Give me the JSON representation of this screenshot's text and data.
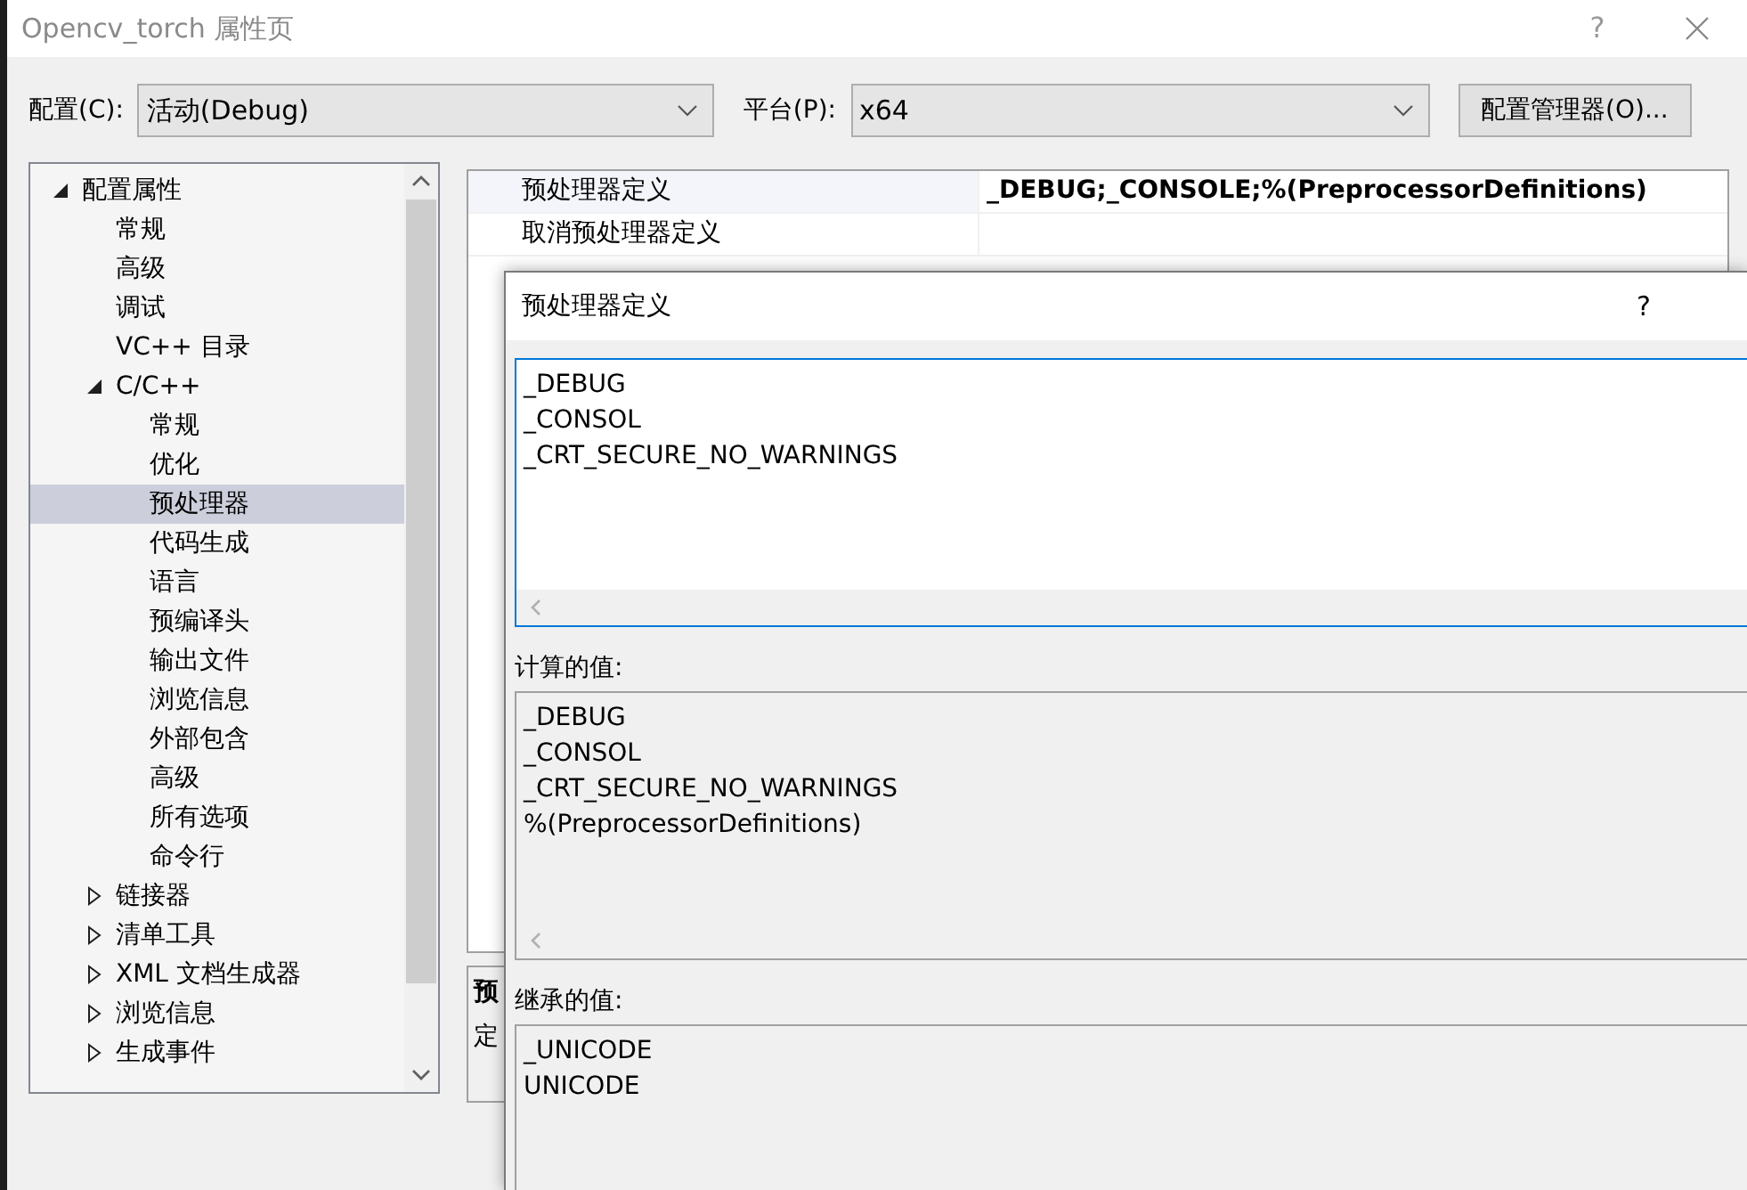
{
  "window": {
    "title": "Opencv_torch 属性页",
    "help": "?"
  },
  "config": {
    "label": "配置(C):",
    "value": "活动(Debug)"
  },
  "platform": {
    "label": "平台(P):",
    "value": "x64"
  },
  "manager_button": "配置管理器(O)...",
  "tree": [
    {
      "label": "配置属性",
      "expanded": true,
      "selected": false,
      "children": [
        {
          "label": "常规",
          "selected": false
        },
        {
          "label": "高级",
          "selected": false
        },
        {
          "label": "调试",
          "selected": false
        },
        {
          "label": "VC++ 目录",
          "selected": false
        },
        {
          "label": "C/C++",
          "expanded": true,
          "selected": false,
          "children": [
            {
              "label": "常规",
              "selected": false
            },
            {
              "label": "优化",
              "selected": false
            },
            {
              "label": "预处理器",
              "selected": true
            },
            {
              "label": "代码生成",
              "selected": false
            },
            {
              "label": "语言",
              "selected": false
            },
            {
              "label": "预编译头",
              "selected": false
            },
            {
              "label": "输出文件",
              "selected": false
            },
            {
              "label": "浏览信息",
              "selected": false
            },
            {
              "label": "外部包含",
              "selected": false
            },
            {
              "label": "高级",
              "selected": false
            },
            {
              "label": "所有选项",
              "selected": false
            },
            {
              "label": "命令行",
              "selected": false
            }
          ]
        },
        {
          "label": "链接器",
          "expanded": false,
          "selected": false
        },
        {
          "label": "清单工具",
          "expanded": false,
          "selected": false
        },
        {
          "label": "XML 文档生成器",
          "expanded": false,
          "selected": false
        },
        {
          "label": "浏览信息",
          "expanded": false,
          "selected": false
        },
        {
          "label": "生成事件",
          "expanded": false,
          "selected": false
        }
      ]
    }
  ],
  "properties": [
    {
      "name": "预处理器定义",
      "value": "_DEBUG;_CONSOLE;%(PreprocessorDefinitions)",
      "selected": true,
      "modified": true
    },
    {
      "name": "取消预处理器定义",
      "selected": false
    }
  ],
  "description": {
    "title": "预",
    "text": "定"
  },
  "dialog": {
    "title": "预处理器定义",
    "help": "?",
    "edit_lines": [
      "_DEBUG",
      "_CONSOL",
      "_CRT_SECURE_NO_WARNINGS"
    ],
    "computed_label": "计算的值:",
    "computed_lines": [
      "_DEBUG",
      "_CONSOL",
      "_CRT_SECURE_NO_WARNINGS",
      "%(PreprocessorDefinitions)"
    ],
    "inherited_label": "继承的值:",
    "inherited_lines": [
      "_UNICODE",
      "UNICODE"
    ]
  }
}
